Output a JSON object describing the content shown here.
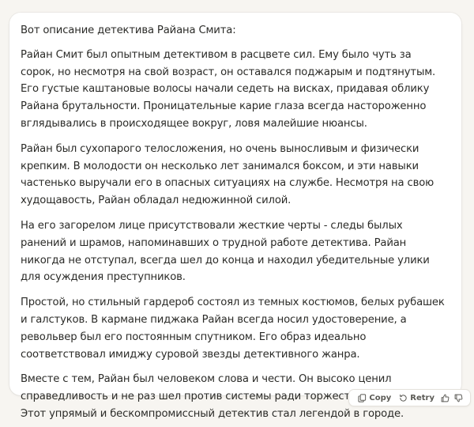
{
  "message": {
    "intro": "Вот описание детектива Райана Смита:",
    "paragraphs": [
      "Райан Смит был опытным детективом в расцвете сил. Ему было чуть за сорок, но несмотря на свой возраст, он оставался поджарым и подтянутым. Его густые каштановые волосы начали седеть на висках, придавая облику Райана брутальности. Проницательные карие глаза всегда настороженно вглядывались в происходящее вокруг, ловя малейшие нюансы.",
      "Райан был сухопарого телосложения, но очень выносливым и физически крепким. В молодости он несколько лет занимался боксом, и эти навыки частенько выручали его в опасных ситуациях на службе. Несмотря на свою худощавость, Райан обладал недюжинной силой.",
      "На его загорелом лице присутствовали жесткие черты - следы былых ранений и шрамов, напоминавших о трудной работе детектива. Райан никогда не отступал, всегда шел до конца и находил убедительные улики для осуждения преступников.",
      "Простой, но стильный гардероб состоял из темных костюмов, белых рубашек и галстуков. В кармане пиджака Райан всегда носил удостоверение, а револьвер был его постоянным спутником. Его образ идеально соответствовал имиджу суровой звезды детективного жанра.",
      "Вместе с тем, Райан был человеком слова и чести. Он высоко ценил справедливость и не раз шел против системы ради торжества правосудия. Этот упрямый и бескомпромиссный детектив стал легендой в городе."
    ]
  },
  "actions": {
    "copy_label": "Copy",
    "retry_label": "Retry",
    "copy_icon": "copy-icon",
    "retry_icon": "retry-icon",
    "thumbs_up_icon": "thumbs-up-icon",
    "thumbs_down_icon": "thumbs-down-icon"
  },
  "colors": {
    "background": "#f7f5f1",
    "card": "#ffffff",
    "text": "#2b2b28",
    "muted": "#5b5a55"
  }
}
